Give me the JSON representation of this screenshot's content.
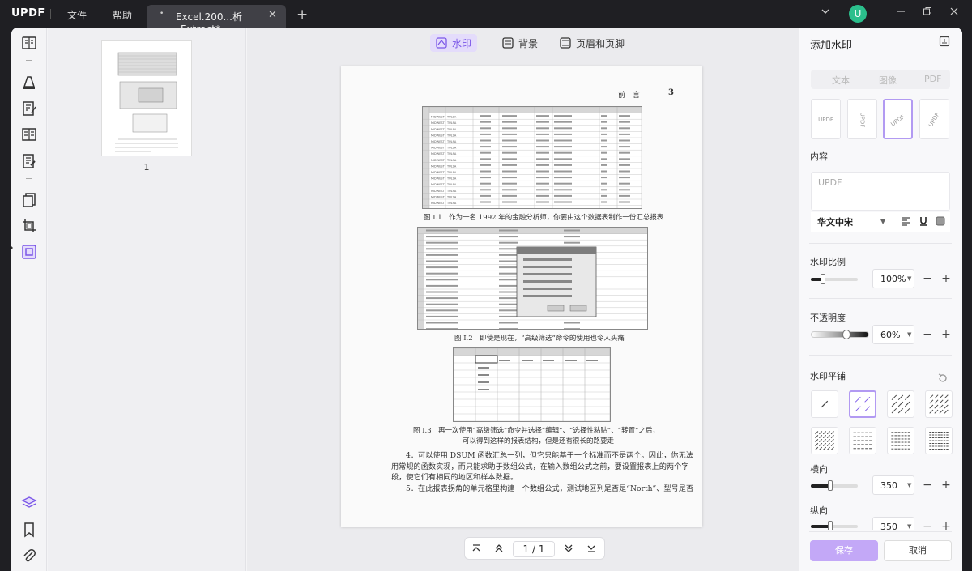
{
  "app": {
    "logo_main": "UPDF",
    "logo_accent": ""
  },
  "menu": {
    "file": "文件",
    "help": "帮助"
  },
  "tab": {
    "modified_marker": "•",
    "title": "Excel.200...析_Extract*",
    "close": "✕"
  },
  "window": {
    "new_tab": "+",
    "user_initial": "U"
  },
  "toolbar": {
    "watermark": "水印",
    "background": "背景",
    "header_footer": "页眉和页脚"
  },
  "thumbnail": {
    "page_number": "1"
  },
  "document": {
    "header_text": "前　言",
    "page_num": "3",
    "fig1_caption": "图 I.1　作为一名 1992 年的金融分析师，你要由这个数据表制作一份汇总报表",
    "fig2_caption": "图 I.2　即使是现在，“高级筛选”命令的使用也令人头痛",
    "fig3_caption_line1": "图 I.3　再一次使用“高级筛选”命令并选择“编辑”、“选择性粘贴”、“转置”之后，",
    "fig3_caption_line2": "可以得到这样的报表结构，但是还有很长的路要走",
    "para_lines": [
      "4．可以使用 DSUM 函数汇总一列，但它只能基于一个标准而不是两个。因此，你无法",
      "用常规的函数实现，而只能求助于数组公式，在输入数组公式之前，要设置报表上的两个字",
      "段，使它们有相同的地区和样本数据。",
      "5．在此报表拐角的单元格里构建一个数组公式，测试地区列是否是“North”、型号是否"
    ],
    "fig1_region_label": "MIDWEST",
    "fig1_state_label": "TULSA"
  },
  "pager": {
    "current": "1",
    "sep": "/",
    "total": "1"
  },
  "panel": {
    "title": "添加水印",
    "tabs": [
      "文本",
      "图像",
      "PDF"
    ],
    "style_label": "UPDF",
    "content_label": "内容",
    "content_placeholder": "UPDF",
    "font_name": "华文中宋",
    "ratio_label": "水印比例",
    "ratio_value": "100%",
    "ratio_fraction": 0.25,
    "opacity_label": "不透明度",
    "opacity_value": "60%",
    "tile_label": "水印平铺",
    "horizontal_label": "横向",
    "horizontal_value": "350",
    "vertical_label": "纵向",
    "vertical_value": "350",
    "save": "保存",
    "cancel": "取消"
  },
  "colors": {
    "accent": "#7b57e8",
    "accent_light": "#e4dcfb",
    "save_button": "#c3a8f7",
    "avatar": "#2bbf8c",
    "logo_yellow": "#f0c437"
  }
}
